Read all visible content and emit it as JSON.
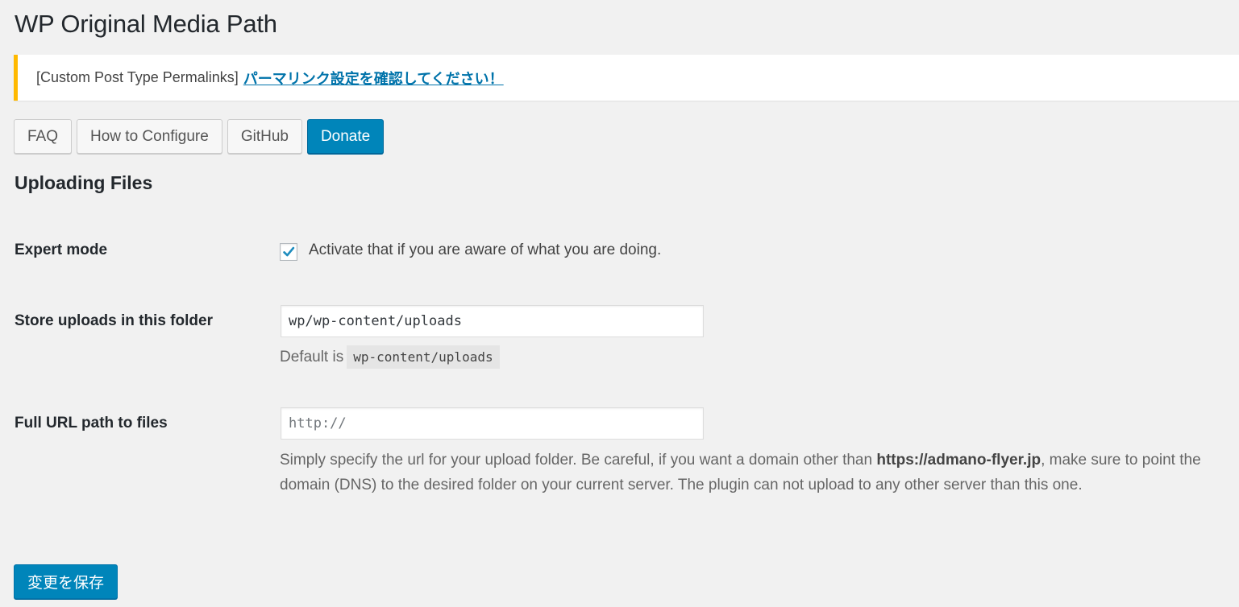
{
  "page": {
    "title": "WP Original Media Path"
  },
  "notice": {
    "prefix": "[Custom Post Type Permalinks]",
    "link_text": "パーマリンク設定を確認してください！",
    "accent_color": "#ffb900"
  },
  "toolbar": {
    "buttons": [
      {
        "label": "FAQ"
      },
      {
        "label": "How to Configure"
      },
      {
        "label": "GitHub"
      },
      {
        "label": "Donate",
        "primary": true
      }
    ]
  },
  "section": {
    "title": "Uploading Files"
  },
  "fields": {
    "expert_mode": {
      "label": "Expert mode",
      "checked": true,
      "checkbox_text": "Activate that if you are aware of what you are doing."
    },
    "upload_folder": {
      "label": "Store uploads in this folder",
      "value": "wp/wp-content/uploads",
      "default_prefix": "Default is",
      "default_value": "wp-content/uploads"
    },
    "url_path": {
      "label": "Full URL path to files",
      "value": "",
      "placeholder": "http://",
      "desc_before": "Simply specify the url for your upload folder. Be careful, if you want a domain other than ",
      "desc_domain": "https://admano-flyer.jp",
      "desc_after": ", make sure to point the domain (DNS) to the desired folder on your current server. The plugin can not upload to any other server than this one."
    }
  },
  "save_button": {
    "label": "変更を保存"
  },
  "colors": {
    "primary": "#0085ba",
    "link": "#0073aa",
    "background": "#f1f1f1"
  }
}
